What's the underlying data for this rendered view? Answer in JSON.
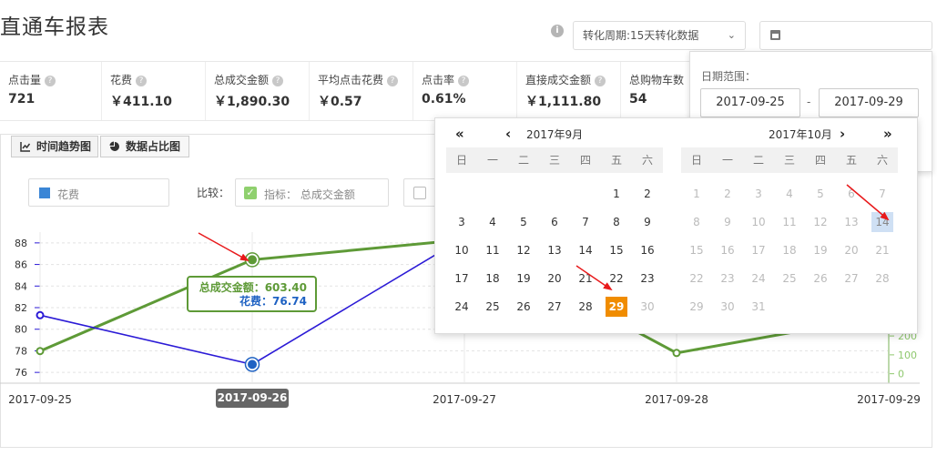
{
  "header": {
    "title": "直通车报表",
    "period_select": "转化周期:15天转化数据",
    "date_input_value": ""
  },
  "metrics": [
    {
      "label": "点击量",
      "value": "721"
    },
    {
      "label": "花费",
      "value": "￥411.10"
    },
    {
      "label": "总成交金额",
      "value": "￥1,890.30"
    },
    {
      "label": "平均点击花费",
      "value": "￥0.57"
    },
    {
      "label": "点击率",
      "value": "0.61%"
    },
    {
      "label": "直接成交金额",
      "value": "￥1,111.80"
    },
    {
      "label": "总购物车数",
      "value": "54"
    }
  ],
  "tabs": [
    "时间趋势图",
    "数据占比图"
  ],
  "legend": {
    "primary": "花费",
    "compare_label": "比较：",
    "compare_metric": "指标： 总成交金额"
  },
  "date_range": {
    "label": "日期范围：",
    "start": "2017-09-25",
    "end": "2017-09-29",
    "separator": "-"
  },
  "calendar": {
    "prev_year": "«",
    "prev_month": "‹",
    "next_month": "›",
    "next_year": "»",
    "left": {
      "title": "2017年9月",
      "weekdays": [
        "日",
        "一",
        "二",
        "三",
        "四",
        "五",
        "六"
      ],
      "weeks": [
        [
          "",
          "",
          "",
          "",
          "",
          "1",
          "2"
        ],
        [
          "3",
          "4",
          "5",
          "6",
          "7",
          "8",
          "9"
        ],
        [
          "10",
          "11",
          "12",
          "13",
          "14",
          "15",
          "16"
        ],
        [
          "17",
          "18",
          "19",
          "20",
          "21",
          "22",
          "23"
        ],
        [
          "24",
          "25",
          "26",
          "27",
          "28",
          "29",
          "30"
        ]
      ],
      "selected_day": "29",
      "disabled_from": "30"
    },
    "right": {
      "title": "2017年10月",
      "weekdays": [
        "日",
        "一",
        "二",
        "三",
        "四",
        "五",
        "六"
      ],
      "weeks": [
        [
          "1",
          "2",
          "3",
          "4",
          "5",
          "6",
          "7"
        ],
        [
          "8",
          "9",
          "10",
          "11",
          "12",
          "13",
          "14"
        ],
        [
          "15",
          "16",
          "17",
          "18",
          "19",
          "20",
          "21"
        ],
        [
          "22",
          "23",
          "24",
          "25",
          "26",
          "27",
          "28"
        ],
        [
          "29",
          "30",
          "31",
          "",
          "",
          "",
          ""
        ]
      ],
      "today_day": "14"
    }
  },
  "tooltip": {
    "line1": "总成交金额：603.40",
    "line2": "花费：76.74"
  },
  "colors": {
    "spend": "#2b1ad6",
    "gmv": "#5e9a37",
    "annotation_arrow": "#e8191b",
    "selected_day": "#f08c00"
  },
  "icons": [
    "info-icon",
    "chevron-down-icon",
    "calendar-icon",
    "help-icon",
    "line-chart-icon",
    "pie-chart-icon",
    "checkbox-checked-icon",
    "double-chevron-left-icon",
    "chevron-left-icon",
    "chevron-right-icon",
    "double-chevron-right-icon",
    "arrow-icon"
  ],
  "chart_data": {
    "type": "line",
    "x": [
      "2017-09-25",
      "2017-09-26",
      "2017-09-27",
      "2017-09-28",
      "2017-09-29"
    ],
    "highlight_x": "2017-09-26",
    "series": [
      {
        "name": "花费",
        "axis": "left",
        "values": [
          81.3,
          76.74,
          88.5,
          null,
          null
        ]
      },
      {
        "name": "总成交金额",
        "axis": "right",
        "values": [
          120,
          603.4,
          710,
          110,
          310
        ]
      }
    ],
    "left_axis": {
      "ticks": [
        76,
        78,
        80,
        82,
        84,
        86,
        88
      ],
      "ylim": [
        75,
        89
      ]
    },
    "right_axis": {
      "ticks": [
        0,
        100,
        200
      ],
      "ylim": [
        -50,
        750
      ]
    }
  }
}
